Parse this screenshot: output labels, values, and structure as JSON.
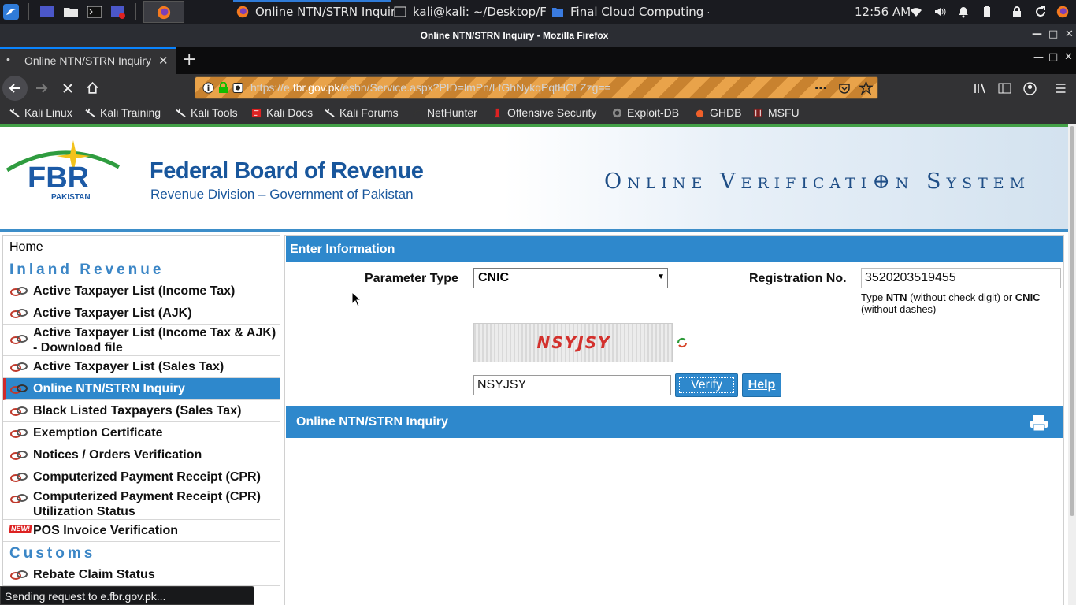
{
  "taskbar": {
    "tasks": [
      {
        "label": "Online NTN/STRN Inquir..."
      },
      {
        "label": "kali@kali: ~/Desktop/Fi..."
      },
      {
        "label": "Final Cloud Computing - ..."
      }
    ],
    "time": "12:56 AM"
  },
  "window": {
    "title": "Online NTN/STRN Inquiry - Mozilla Firefox",
    "tab_label": "Online NTN/STRN Inquiry"
  },
  "navbar": {
    "url_prefix": "https://e.",
    "url_domain": "fbr.gov.pk",
    "url_path": "/esbn/Service.aspx?PID=lmPn/LtGhNykqPqtHCLZzg=="
  },
  "bookmarks": [
    {
      "label": "Kali Linux",
      "icon": "kali-dragon-icon"
    },
    {
      "label": "Kali Training",
      "icon": "kali-dragon-icon"
    },
    {
      "label": "Kali Tools",
      "icon": "kali-dragon-icon"
    },
    {
      "label": "Kali Docs",
      "icon": "kali-docs-icon"
    },
    {
      "label": "Kali Forums",
      "icon": "kali-dragon-icon"
    },
    {
      "label": "NetHunter",
      "icon": "nethunter-icon"
    },
    {
      "label": "Offensive Security",
      "icon": "offsec-icon"
    },
    {
      "label": "Exploit-DB",
      "icon": "exploitdb-icon"
    },
    {
      "label": "GHDB",
      "icon": "ghdb-icon"
    },
    {
      "label": "MSFU",
      "icon": "msfu-icon"
    }
  ],
  "header": {
    "logo_text": "FBR",
    "logo_sub": "PAKISTAN",
    "org_name": "Federal Board of Revenue",
    "org_sub": "Revenue Division – Government of Pakistan",
    "system_title": "Online Verificati⊕n System"
  },
  "sidebar": {
    "home": "Home",
    "section_inland": "Inland Revenue",
    "section_customs": "Customs",
    "items": [
      {
        "label": "Active Taxpayer List (Income Tax)"
      },
      {
        "label": "Active Taxpayer List (AJK)"
      },
      {
        "label": "Active Taxpayer List (Income Tax & AJK) - Download file"
      },
      {
        "label": "Active Taxpayer List (Sales Tax)"
      },
      {
        "label": "Online NTN/STRN Inquiry"
      },
      {
        "label": "Black Listed Taxpayers (Sales Tax)"
      },
      {
        "label": "Exemption Certificate"
      },
      {
        "label": "Notices / Orders Verification"
      },
      {
        "label": "Computerized Payment Receipt (CPR)"
      },
      {
        "label": "Computerized Payment Receipt (CPR) Utilization Status"
      },
      {
        "label": "POS Invoice Verification",
        "badge": "NEW!"
      }
    ],
    "customs_items": [
      {
        "label": "Rebate Claim Status"
      }
    ]
  },
  "form": {
    "section_title": "Enter Information",
    "param_label": "Parameter Type",
    "param_value": "CNIC",
    "reg_label": "Registration No.",
    "reg_value": "3520203519455",
    "hint_1": "Type ",
    "hint_ntn": "NTN",
    "hint_2": " (without check digit) or ",
    "hint_cnic": "CNIC",
    "hint_3": " (without dashes)",
    "captcha_image_text": "NSYJSY",
    "captcha_value": "NSYJSY",
    "verify_label": "Verify",
    "help_label": "Help"
  },
  "result": {
    "title": "Online NTN/STRN Inquiry"
  },
  "status_text": "Sending request to e.fbr.gov.pk..."
}
